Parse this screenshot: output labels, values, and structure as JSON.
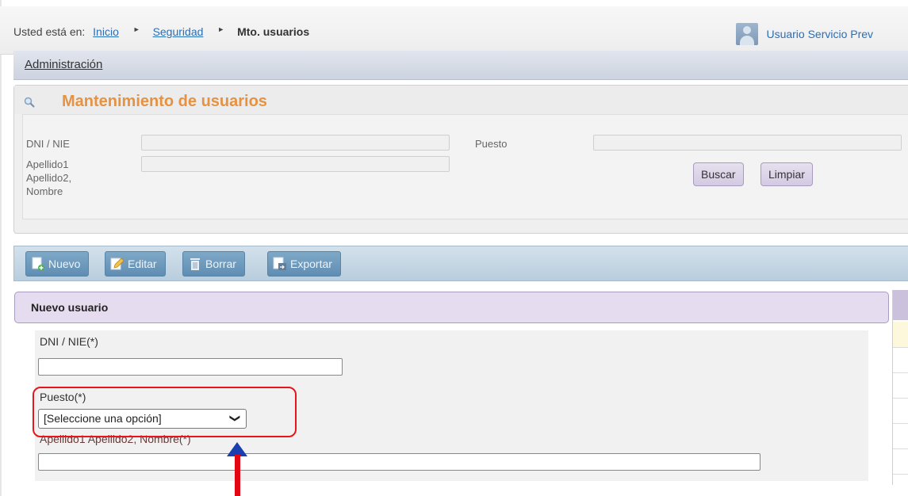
{
  "breadcrumb": {
    "prefix": "Usted está en:",
    "items": [
      "Inicio",
      "Seguridad"
    ],
    "current": "Mto. usuarios"
  },
  "user": {
    "name": "Usuario Servicio Prev"
  },
  "admin_menu": {
    "label": "Administración"
  },
  "search": {
    "title": "Mantenimiento de usuarios",
    "dni_label": "DNI / NIE",
    "puesto_label": "Puesto",
    "nombre_label_lines": [
      "Apellido1",
      "Apellido2,",
      "Nombre"
    ],
    "buscar_label": "Buscar",
    "limpiar_label": "Limpiar"
  },
  "toolbar": {
    "nuevo": "Nuevo",
    "editar": "Editar",
    "borrar": "Borrar",
    "exportar": "Exportar"
  },
  "new_user_form": {
    "title": "Nuevo usuario",
    "dni_label": "DNI / NIE(*)",
    "puesto_label": "Puesto(*)",
    "puesto_selected": "[Seleccione una opción]",
    "nombre_label": "Apellido1 Apellido2, Nombre(*)"
  },
  "colors": {
    "accent_title": "#e69240",
    "link": "#2a6fb6",
    "highlight": "#e8161b"
  }
}
